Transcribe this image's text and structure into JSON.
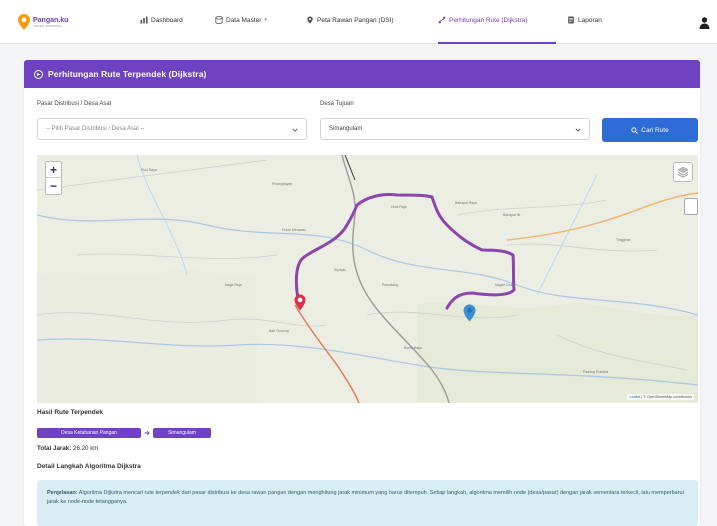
{
  "brand": {
    "name": "Pangan.ku",
    "tagline": "SISTEM INFORMASI"
  },
  "nav": {
    "items": [
      {
        "label": "Dashboard",
        "icon": "chart-icon"
      },
      {
        "label": "Data Master",
        "icon": "database-icon"
      },
      {
        "label": "Peta Rawan Pangan (DSI)",
        "icon": "map-icon"
      },
      {
        "label": "Perhitungan Rute (Dijkstra)",
        "icon": "route-icon"
      },
      {
        "label": "Laporan",
        "icon": "report-icon"
      }
    ],
    "active_index": 3
  },
  "card": {
    "title": "Perhitungan Rute Terpendek (Dijkstra)"
  },
  "form": {
    "origin_label": "Pasar Distribusi / Desa Asal",
    "origin_placeholder": "-- Pilih Pasar Distribusi / Desa Asal --",
    "dest_label": "Desa Tujuan",
    "dest_value": "Simangulam",
    "search_label": "Cari Rute"
  },
  "map": {
    "zoom_in": "+",
    "zoom_out": "−",
    "attribution_leaflet": "Leaflet",
    "attribution_rest": " | © OpenStreetMap contributors",
    "labels": [
      "Pulo Bayu",
      "Pinangbayan",
      "Bahapal Raya",
      "Dolok Merawan",
      "Bahapal Ilir",
      "Huta Raja",
      "Sipispis",
      "Pamatang",
      "Naga Raja",
      "Nagori Dolok",
      "Bah Gunung",
      "Buntu Bayu",
      "Tinggiran",
      "Padang Rumbia"
    ],
    "colors": {
      "route": "#8e44ad",
      "origin": "#e0304f",
      "destination": "#3a8fd4"
    }
  },
  "result": {
    "title": "Hasil Rute Terpendek",
    "from_badge": "Desa Ketahanan Pangan",
    "to_badge": "Simangulam",
    "total_label": "Total Jarak:",
    "total_value": "26.20 km"
  },
  "steps": {
    "title": "Detail Langkah Algoritma Dijkstra",
    "info_label": "Penjelasan:",
    "info_text": " Algoritma Dijkstra mencari rute terpendek dari pasar distribusi ke desa rawan pangan dengan menghitung jarak minimum yang harus ditempuh. Setiap langkah, algoritma memilih node (desa/pasar) dengan jarak sementara terkecil, lalu memperbarui jarak ke node-node tetangganya."
  },
  "colors": {
    "accent": "#6f42c1",
    "button": "#2e6bd6",
    "info_bg": "#d8eef4"
  }
}
